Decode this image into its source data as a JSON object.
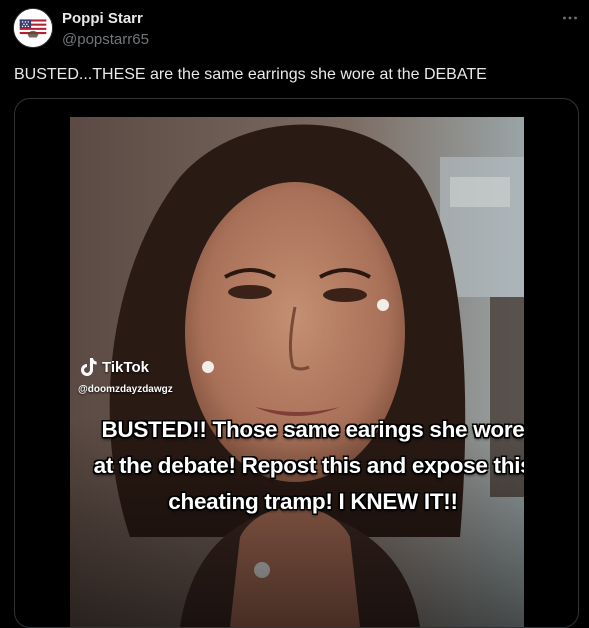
{
  "post": {
    "author_name": "Poppi Starr",
    "author_handle": "@popstarr65",
    "text": "BUSTED...THESE are the same earrings she wore at the DEBATE",
    "avatar_icon": "us-flag-avatar-icon",
    "more_icon": "more-options-icon"
  },
  "video": {
    "watermark_brand": "TikTok",
    "watermark_user": "@doomzdayzdawgz",
    "caption": "BUSTED!! Those same earings she wore at the debate! Repost this and expose this cheating tramp! I KNEW IT!!"
  },
  "colors": {
    "background": "#000000",
    "text_primary": "#e7e9ea",
    "text_secondary": "#71767b",
    "border": "#2f3336"
  }
}
